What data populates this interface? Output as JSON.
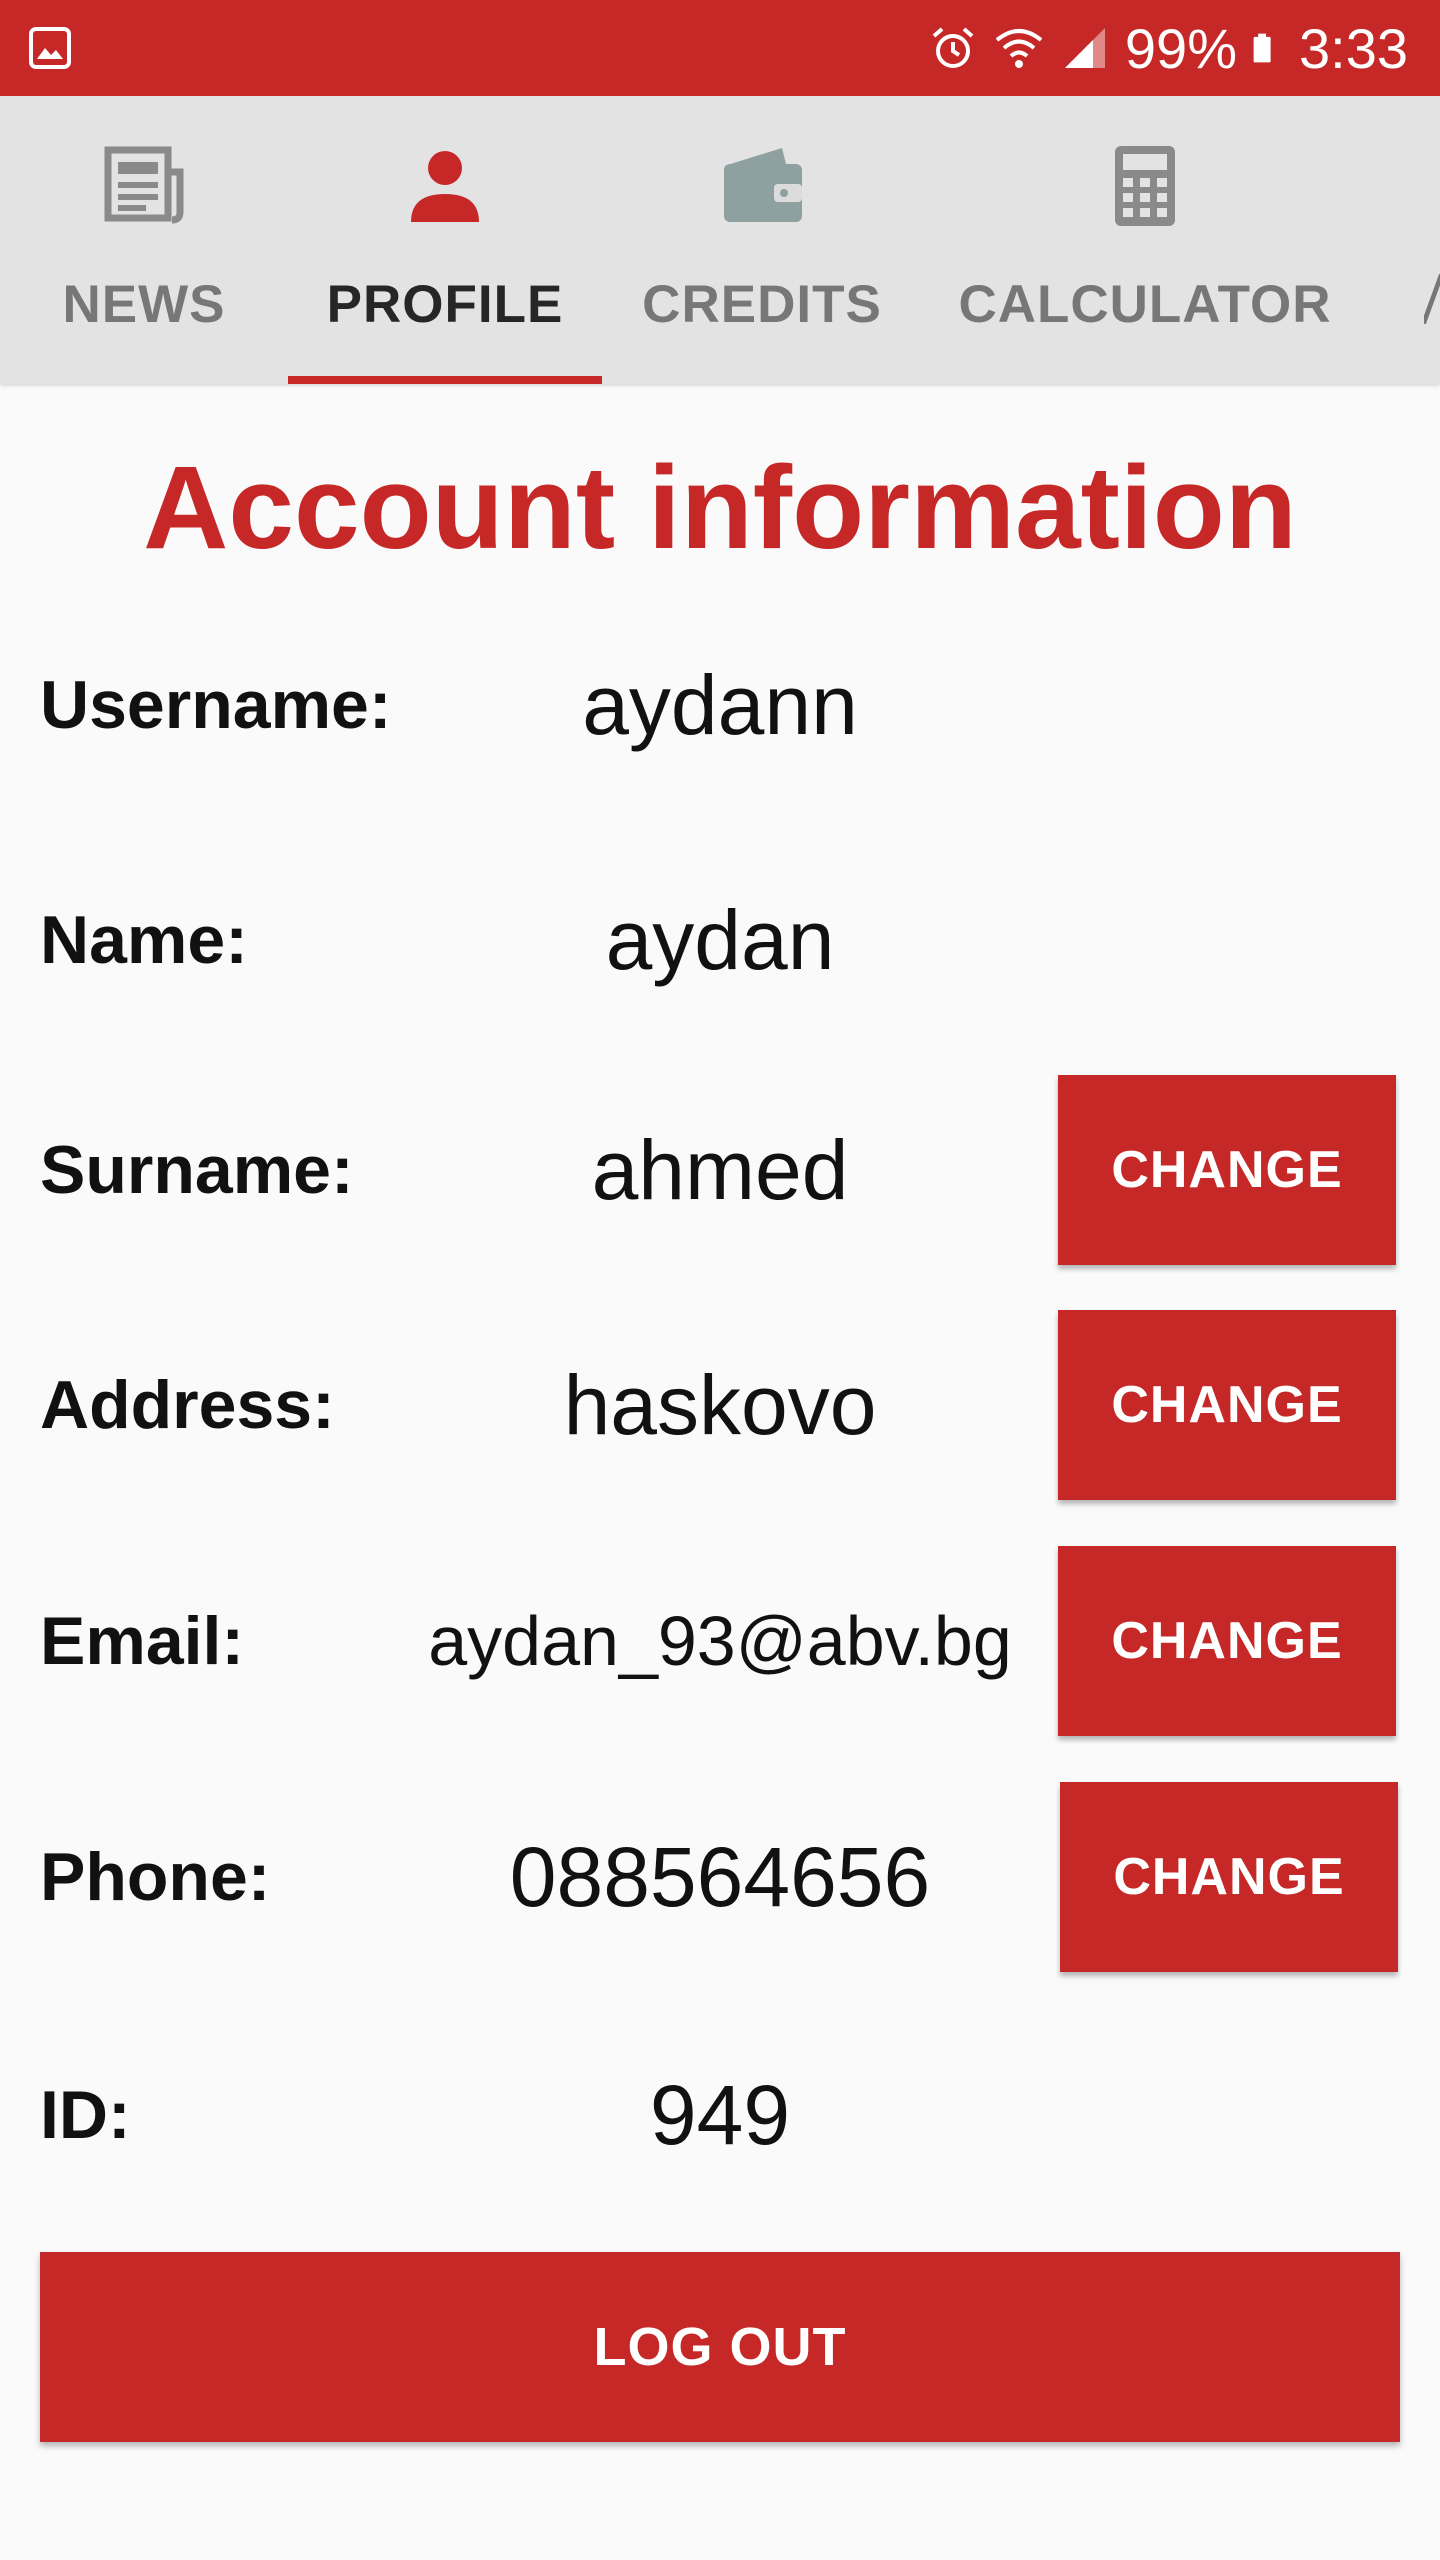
{
  "colors": {
    "accent": "#c62828",
    "tab_bar_bg": "#e3e3e3",
    "inactive_tab": "#777777",
    "icon_grey": "#8a8a8a",
    "credits_icon": "#8fa0a0"
  },
  "status_bar": {
    "left_icon": "gallery-icon",
    "icons": [
      "alarm-icon",
      "wifi-icon",
      "signal-icon",
      "battery-icon"
    ],
    "battery": "99%",
    "time": "3:33"
  },
  "tabs": [
    {
      "label": "NEWS",
      "icon": "newspaper-icon",
      "active": false
    },
    {
      "label": "PROFILE",
      "icon": "person-icon",
      "active": true
    },
    {
      "label": "CREDITS",
      "icon": "wallet-icon",
      "active": false
    },
    {
      "label": "CALCULATOR",
      "icon": "calculator-icon",
      "active": false
    }
  ],
  "title": "Account information",
  "fields": [
    {
      "label": "Username:",
      "value": "aydann"
    },
    {
      "label": "Name:",
      "value": "aydan"
    },
    {
      "label": "Surname:",
      "value": "ahmed",
      "action": "CHANGE"
    },
    {
      "label": "Address:",
      "value": "haskovo",
      "action": "CHANGE"
    },
    {
      "label": "Email:",
      "value": "aydan_93@abv.bg",
      "action": "CHANGE"
    },
    {
      "label": "Phone:",
      "value": "088564656",
      "action": "CHANGE"
    },
    {
      "label": "ID:",
      "value": "949"
    }
  ],
  "logout_label": "LOG OUT"
}
